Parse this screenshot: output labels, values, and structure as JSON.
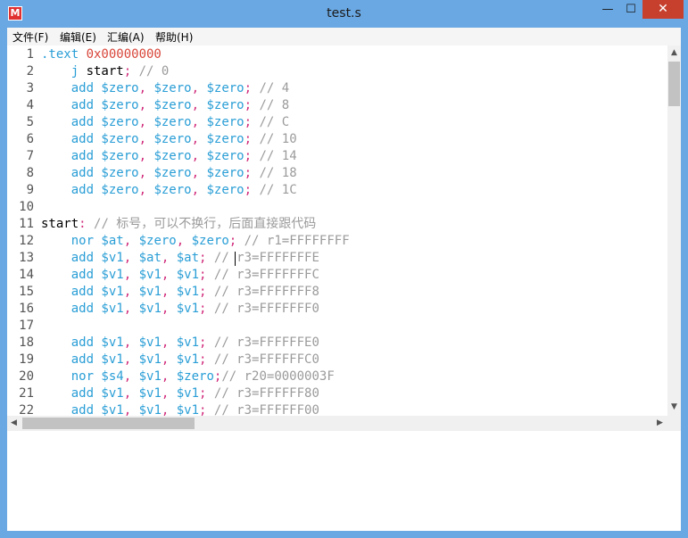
{
  "window": {
    "title": "test.s",
    "icon_label": "M",
    "minimize": "—",
    "maximize": "☐",
    "close": "✕"
  },
  "menu": [
    "文件(F)",
    "编辑(E)",
    "汇编(A)",
    "帮助(H)"
  ],
  "colors": {
    "titlebar": "#6aa8e3",
    "close": "#c7402e",
    "directive": "#2a9ed6",
    "number": "#d8463a",
    "punct": "#d02a7a",
    "comment": "#9b9b9b"
  },
  "lines": [
    {
      "n": "1",
      "tokens": [
        {
          "t": ".text ",
          "c": "dir"
        },
        {
          "t": "0x00000000",
          "c": "num"
        }
      ]
    },
    {
      "n": "2",
      "tokens": [
        {
          "t": "    j ",
          "c": "kw"
        },
        {
          "t": "start",
          "c": "plain"
        },
        {
          "t": ";",
          "c": "punct"
        },
        {
          "t": " // 0",
          "c": "cmt"
        }
      ]
    },
    {
      "n": "3",
      "tokens": [
        {
          "t": "    add $zero",
          "c": "kw"
        },
        {
          "t": ",",
          "c": "punct"
        },
        {
          "t": " $zero",
          "c": "reg"
        },
        {
          "t": ",",
          "c": "punct"
        },
        {
          "t": " $zero",
          "c": "reg"
        },
        {
          "t": ";",
          "c": "punct"
        },
        {
          "t": " // 4",
          "c": "cmt"
        }
      ]
    },
    {
      "n": "4",
      "tokens": [
        {
          "t": "    add $zero",
          "c": "kw"
        },
        {
          "t": ",",
          "c": "punct"
        },
        {
          "t": " $zero",
          "c": "reg"
        },
        {
          "t": ",",
          "c": "punct"
        },
        {
          "t": " $zero",
          "c": "reg"
        },
        {
          "t": ";",
          "c": "punct"
        },
        {
          "t": " // 8",
          "c": "cmt"
        }
      ]
    },
    {
      "n": "5",
      "tokens": [
        {
          "t": "    add $zero",
          "c": "kw"
        },
        {
          "t": ",",
          "c": "punct"
        },
        {
          "t": " $zero",
          "c": "reg"
        },
        {
          "t": ",",
          "c": "punct"
        },
        {
          "t": " $zero",
          "c": "reg"
        },
        {
          "t": ";",
          "c": "punct"
        },
        {
          "t": " // C",
          "c": "cmt"
        }
      ]
    },
    {
      "n": "6",
      "tokens": [
        {
          "t": "    add $zero",
          "c": "kw"
        },
        {
          "t": ",",
          "c": "punct"
        },
        {
          "t": " $zero",
          "c": "reg"
        },
        {
          "t": ",",
          "c": "punct"
        },
        {
          "t": " $zero",
          "c": "reg"
        },
        {
          "t": ";",
          "c": "punct"
        },
        {
          "t": " // 10",
          "c": "cmt"
        }
      ]
    },
    {
      "n": "7",
      "tokens": [
        {
          "t": "    add $zero",
          "c": "kw"
        },
        {
          "t": ",",
          "c": "punct"
        },
        {
          "t": " $zero",
          "c": "reg"
        },
        {
          "t": ",",
          "c": "punct"
        },
        {
          "t": " $zero",
          "c": "reg"
        },
        {
          "t": ";",
          "c": "punct"
        },
        {
          "t": " // 14",
          "c": "cmt"
        }
      ]
    },
    {
      "n": "8",
      "tokens": [
        {
          "t": "    add $zero",
          "c": "kw"
        },
        {
          "t": ",",
          "c": "punct"
        },
        {
          "t": " $zero",
          "c": "reg"
        },
        {
          "t": ",",
          "c": "punct"
        },
        {
          "t": " $zero",
          "c": "reg"
        },
        {
          "t": ";",
          "c": "punct"
        },
        {
          "t": " // 18",
          "c": "cmt"
        }
      ]
    },
    {
      "n": "9",
      "tokens": [
        {
          "t": "    add $zero",
          "c": "kw"
        },
        {
          "t": ",",
          "c": "punct"
        },
        {
          "t": " $zero",
          "c": "reg"
        },
        {
          "t": ",",
          "c": "punct"
        },
        {
          "t": " $zero",
          "c": "reg"
        },
        {
          "t": ";",
          "c": "punct"
        },
        {
          "t": " // 1C",
          "c": "cmt"
        }
      ]
    },
    {
      "n": "10",
      "tokens": []
    },
    {
      "n": "11",
      "tokens": [
        {
          "t": "start",
          "c": "lbl"
        },
        {
          "t": ":",
          "c": "punct"
        },
        {
          "t": " // 标号，可以不换行，后面直接跟代码",
          "c": "cmt"
        }
      ]
    },
    {
      "n": "12",
      "tokens": [
        {
          "t": "    nor $at",
          "c": "kw"
        },
        {
          "t": ",",
          "c": "punct"
        },
        {
          "t": " $zero",
          "c": "reg"
        },
        {
          "t": ",",
          "c": "punct"
        },
        {
          "t": " $zero",
          "c": "reg"
        },
        {
          "t": ";",
          "c": "punct"
        },
        {
          "t": " // r1=FFFFFFFF",
          "c": "cmt"
        }
      ]
    },
    {
      "n": "13",
      "tokens": [
        {
          "t": "    add $v1",
          "c": "kw"
        },
        {
          "t": ",",
          "c": "punct"
        },
        {
          "t": " $at",
          "c": "reg"
        },
        {
          "t": ",",
          "c": "punct"
        },
        {
          "t": " $at",
          "c": "reg"
        },
        {
          "t": ";",
          "c": "punct"
        },
        {
          "t": " // r3=FFFFFFFE",
          "c": "cmt"
        }
      ]
    },
    {
      "n": "14",
      "tokens": [
        {
          "t": "    add $v1",
          "c": "kw"
        },
        {
          "t": ",",
          "c": "punct"
        },
        {
          "t": " $v1",
          "c": "reg"
        },
        {
          "t": ",",
          "c": "punct"
        },
        {
          "t": " $v1",
          "c": "reg"
        },
        {
          "t": ";",
          "c": "punct"
        },
        {
          "t": " // r3=FFFFFFFC",
          "c": "cmt"
        }
      ]
    },
    {
      "n": "15",
      "tokens": [
        {
          "t": "    add $v1",
          "c": "kw"
        },
        {
          "t": ",",
          "c": "punct"
        },
        {
          "t": " $v1",
          "c": "reg"
        },
        {
          "t": ",",
          "c": "punct"
        },
        {
          "t": " $v1",
          "c": "reg"
        },
        {
          "t": ";",
          "c": "punct"
        },
        {
          "t": " // r3=FFFFFFF8",
          "c": "cmt"
        }
      ]
    },
    {
      "n": "16",
      "tokens": [
        {
          "t": "    add $v1",
          "c": "kw"
        },
        {
          "t": ",",
          "c": "punct"
        },
        {
          "t": " $v1",
          "c": "reg"
        },
        {
          "t": ",",
          "c": "punct"
        },
        {
          "t": " $v1",
          "c": "reg"
        },
        {
          "t": ";",
          "c": "punct"
        },
        {
          "t": " // r3=FFFFFFF0",
          "c": "cmt"
        }
      ]
    },
    {
      "n": "17",
      "tokens": []
    },
    {
      "n": "18",
      "tokens": [
        {
          "t": "    add $v1",
          "c": "kw"
        },
        {
          "t": ",",
          "c": "punct"
        },
        {
          "t": " $v1",
          "c": "reg"
        },
        {
          "t": ",",
          "c": "punct"
        },
        {
          "t": " $v1",
          "c": "reg"
        },
        {
          "t": ";",
          "c": "punct"
        },
        {
          "t": " // r3=FFFFFFE0",
          "c": "cmt"
        }
      ]
    },
    {
      "n": "19",
      "tokens": [
        {
          "t": "    add $v1",
          "c": "kw"
        },
        {
          "t": ",",
          "c": "punct"
        },
        {
          "t": " $v1",
          "c": "reg"
        },
        {
          "t": ",",
          "c": "punct"
        },
        {
          "t": " $v1",
          "c": "reg"
        },
        {
          "t": ";",
          "c": "punct"
        },
        {
          "t": " // r3=FFFFFFC0",
          "c": "cmt"
        }
      ]
    },
    {
      "n": "20",
      "tokens": [
        {
          "t": "    nor $s4",
          "c": "kw"
        },
        {
          "t": ",",
          "c": "punct"
        },
        {
          "t": " $v1",
          "c": "reg"
        },
        {
          "t": ",",
          "c": "punct"
        },
        {
          "t": " $zero",
          "c": "reg"
        },
        {
          "t": ";",
          "c": "punct"
        },
        {
          "t": "// r20=0000003F",
          "c": "cmt"
        }
      ]
    },
    {
      "n": "21",
      "tokens": [
        {
          "t": "    add $v1",
          "c": "kw"
        },
        {
          "t": ",",
          "c": "punct"
        },
        {
          "t": " $v1",
          "c": "reg"
        },
        {
          "t": ",",
          "c": "punct"
        },
        {
          "t": " $v1",
          "c": "reg"
        },
        {
          "t": ";",
          "c": "punct"
        },
        {
          "t": " // r3=FFFFFF80",
          "c": "cmt"
        }
      ]
    },
    {
      "n": "22",
      "tokens": [
        {
          "t": "    add $v1",
          "c": "kw"
        },
        {
          "t": ",",
          "c": "punct"
        },
        {
          "t": " $v1",
          "c": "reg"
        },
        {
          "t": ",",
          "c": "punct"
        },
        {
          "t": " $v1",
          "c": "reg"
        },
        {
          "t": ";",
          "c": "punct"
        },
        {
          "t": " // r3=FFFFFF00",
          "c": "cmt"
        }
      ]
    }
  ],
  "scroll": {
    "up": "▲",
    "down": "▼",
    "left": "◀",
    "right": "▶"
  }
}
